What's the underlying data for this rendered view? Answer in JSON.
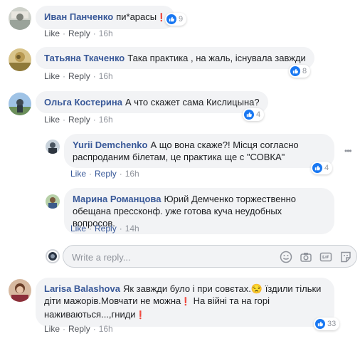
{
  "actions": {
    "like": "Like",
    "reply": "Reply",
    "separator": "·"
  },
  "comments": [
    {
      "name": "Иван Панченко",
      "text": "пи*арасы",
      "emoji": "❗",
      "time": "16h",
      "reactions": "9"
    },
    {
      "name": "Татьяна Ткаченко",
      "text": "Така практика , на жаль, існувала завжди",
      "time": "16h",
      "reactions": "8"
    },
    {
      "name": "Ольга Костерина",
      "text": "А что скажет сама Кислицына?",
      "time": "16h",
      "reactions": "4"
    }
  ],
  "replies": [
    {
      "name": "Yurii Demchenko",
      "line1": "А що вона скаже?! Місця согласно",
      "line2": "распроданим білетам, це практика ще с \"СОВКА\"",
      "time": "16h",
      "reactions": "4"
    },
    {
      "name": "Марина Романцова",
      "line1": "Юрий Демченко торжественно",
      "line2": "обещана прессконф. уже готова куча неудобных вопросов.",
      "time": "14h"
    }
  ],
  "reply_box": {
    "placeholder": "Write a reply..."
  },
  "last_comment": {
    "name": "Larisa Balashova",
    "line1_a": "Як завжди було і при совєтах.",
    "emoji1": "😒",
    "line1_b": " їздили тільки",
    "line2_a": "діти мажорів.Мовчати не можна",
    "emoji2": "❗",
    "line2_b": " На війні та на горі",
    "line3_a": "наживаються...,гниди",
    "emoji3": "❗",
    "time": "16h",
    "reactions": "33"
  },
  "colors": {
    "link": "#385898",
    "bubble": "#f2f3f5",
    "like_blue": "#1877f2",
    "meta": "#90949c"
  },
  "icons": [
    "like-icon",
    "emoji-icon",
    "camera-icon",
    "gif-icon",
    "sticker-icon",
    "more-options-icon"
  ]
}
